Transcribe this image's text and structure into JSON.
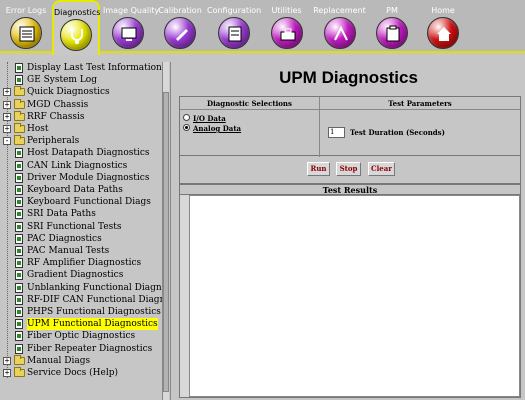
{
  "toolbar": {
    "tabs": [
      {
        "label": "Error Logs",
        "color": "#e8c20a",
        "icon": "list-icon"
      },
      {
        "label": "Diagnostics",
        "color": "#e6e600",
        "icon": "stethoscope-icon"
      },
      {
        "label": "Image Quality",
        "color": "#9b3ad6",
        "icon": "image-monitor-icon"
      },
      {
        "label": "Calibration",
        "color": "#9b3ad6",
        "icon": "wrench-icon"
      },
      {
        "label": "Configuration",
        "color": "#9b3ad6",
        "icon": "checklist-icon"
      },
      {
        "label": "Utilities",
        "color": "#c21ac2",
        "icon": "toolbox-icon"
      },
      {
        "label": "Replacement",
        "color": "#c21ac2",
        "icon": "swap-icon"
      },
      {
        "label": "PM",
        "color": "#c21ac2",
        "icon": "clipboard-icon"
      },
      {
        "label": "Home",
        "color": "#d01010",
        "icon": "home-icon"
      }
    ],
    "active_tab": "Diagnostics"
  },
  "tree": {
    "items": [
      {
        "label": "Display Last Test Information",
        "type": "doc",
        "level": 1
      },
      {
        "label": "GE System Log",
        "type": "doc",
        "level": 1
      },
      {
        "label": "Quick Diagnostics",
        "type": "folder",
        "level": 0,
        "expander": "+"
      },
      {
        "label": "MGD Chassis",
        "type": "folder",
        "level": 0,
        "expander": "+"
      },
      {
        "label": "RRF Chassis",
        "type": "folder",
        "level": 0,
        "expander": "+"
      },
      {
        "label": "Host",
        "type": "folder",
        "level": 0,
        "expander": "+"
      },
      {
        "label": "Peripherals",
        "type": "folder",
        "level": 0,
        "expander": "-"
      },
      {
        "label": "Host Datapath Diagnostics",
        "type": "doc",
        "level": 1
      },
      {
        "label": "CAN Link Diagnostics",
        "type": "doc",
        "level": 1
      },
      {
        "label": "Driver Module Diagnostics",
        "type": "doc",
        "level": 1
      },
      {
        "label": "Keyboard Data Paths",
        "type": "doc",
        "level": 1
      },
      {
        "label": "Keyboard Functional Diags",
        "type": "doc",
        "level": 1
      },
      {
        "label": "SRI Data Paths",
        "type": "doc",
        "level": 1
      },
      {
        "label": "SRI Functional Tests",
        "type": "doc",
        "level": 1
      },
      {
        "label": "PAC Diagnostics",
        "type": "doc",
        "level": 1
      },
      {
        "label": "PAC Manual Tests",
        "type": "doc",
        "level": 1
      },
      {
        "label": "RF Amplifier Diagnostics",
        "type": "doc",
        "level": 1
      },
      {
        "label": "Gradient Diagnostics",
        "type": "doc",
        "level": 1
      },
      {
        "label": "Unblanking Functional Diagnostic",
        "type": "doc",
        "level": 1
      },
      {
        "label": "RF-DIF CAN Functional Diagnos",
        "type": "doc",
        "level": 1
      },
      {
        "label": "PHPS Functional Diagnostics",
        "type": "doc",
        "level": 1
      },
      {
        "label": "UPM Functional Diagnostics",
        "type": "doc",
        "level": 1,
        "selected": true
      },
      {
        "label": "Fiber Optic Diagnostics",
        "type": "doc",
        "level": 1
      },
      {
        "label": "Fiber Repeater Diagnostics",
        "type": "doc",
        "level": 1
      },
      {
        "label": "Manual Diags",
        "type": "folder",
        "level": 0,
        "expander": "+"
      },
      {
        "label": "Service Docs (Help)",
        "type": "folder",
        "level": 0,
        "expander": "+"
      }
    ]
  },
  "main": {
    "title": "UPM Diagnostics",
    "selections_header": "Diagnostic Selections",
    "params_header": "Test Parameters",
    "options": [
      {
        "label": "I/O Data",
        "checked": false
      },
      {
        "label": "Analog Data",
        "checked": true
      }
    ],
    "duration_value": "1",
    "duration_label": "Test Duration (Seconds)",
    "buttons": {
      "run": "Run",
      "stop": "Stop",
      "clear": "Clear"
    },
    "results_header": "Test Results"
  }
}
